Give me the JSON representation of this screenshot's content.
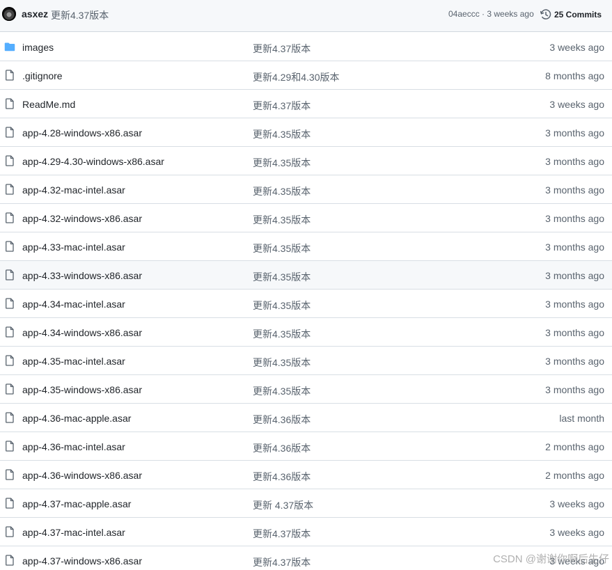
{
  "header": {
    "author": "asxez",
    "message": "更新4.37版本",
    "commit_meta": "04aeccc · 3 weeks ago",
    "commits_label": "25 Commits"
  },
  "files": [
    {
      "type": "folder",
      "name": "images",
      "message": "更新4.37版本",
      "date": "3 weeks ago"
    },
    {
      "type": "file",
      "name": ".gitignore",
      "message": "更新4.29和4.30版本",
      "date": "8 months ago"
    },
    {
      "type": "file",
      "name": "ReadMe.md",
      "message": "更新4.37版本",
      "date": "3 weeks ago"
    },
    {
      "type": "file",
      "name": "app-4.28-windows-x86.asar",
      "message": "更新4.35版本",
      "date": "3 months ago"
    },
    {
      "type": "file",
      "name": "app-4.29-4.30-windows-x86.asar",
      "message": "更新4.35版本",
      "date": "3 months ago"
    },
    {
      "type": "file",
      "name": "app-4.32-mac-intel.asar",
      "message": "更新4.35版本",
      "date": "3 months ago"
    },
    {
      "type": "file",
      "name": "app-4.32-windows-x86.asar",
      "message": "更新4.35版本",
      "date": "3 months ago"
    },
    {
      "type": "file",
      "name": "app-4.33-mac-intel.asar",
      "message": "更新4.35版本",
      "date": "3 months ago"
    },
    {
      "type": "file",
      "name": "app-4.33-windows-x86.asar",
      "message": "更新4.35版本",
      "date": "3 months ago",
      "hover": true
    },
    {
      "type": "file",
      "name": "app-4.34-mac-intel.asar",
      "message": "更新4.35版本",
      "date": "3 months ago"
    },
    {
      "type": "file",
      "name": "app-4.34-windows-x86.asar",
      "message": "更新4.35版本",
      "date": "3 months ago"
    },
    {
      "type": "file",
      "name": "app-4.35-mac-intel.asar",
      "message": "更新4.35版本",
      "date": "3 months ago"
    },
    {
      "type": "file",
      "name": "app-4.35-windows-x86.asar",
      "message": "更新4.35版本",
      "date": "3 months ago"
    },
    {
      "type": "file",
      "name": "app-4.36-mac-apple.asar",
      "message": "更新4.36版本",
      "date": "last month"
    },
    {
      "type": "file",
      "name": "app-4.36-mac-intel.asar",
      "message": "更新4.36版本",
      "date": "2 months ago"
    },
    {
      "type": "file",
      "name": "app-4.36-windows-x86.asar",
      "message": "更新4.36版本",
      "date": "2 months ago"
    },
    {
      "type": "file",
      "name": "app-4.37-mac-apple.asar",
      "message": "更新 4.37版本",
      "date": "3 weeks ago"
    },
    {
      "type": "file",
      "name": "app-4.37-mac-intel.asar",
      "message": "更新4.37版本",
      "date": "3 weeks ago"
    },
    {
      "type": "file",
      "name": "app-4.37-windows-x86.asar",
      "message": "更新4.37版本",
      "date": "3 weeks ago"
    }
  ],
  "watermark": "CSDN @谢谢你啊后生仔",
  "colors": {
    "folder_icon": "#54aeff",
    "file_icon": "#59636e",
    "header_bg": "#f6f8fa"
  }
}
